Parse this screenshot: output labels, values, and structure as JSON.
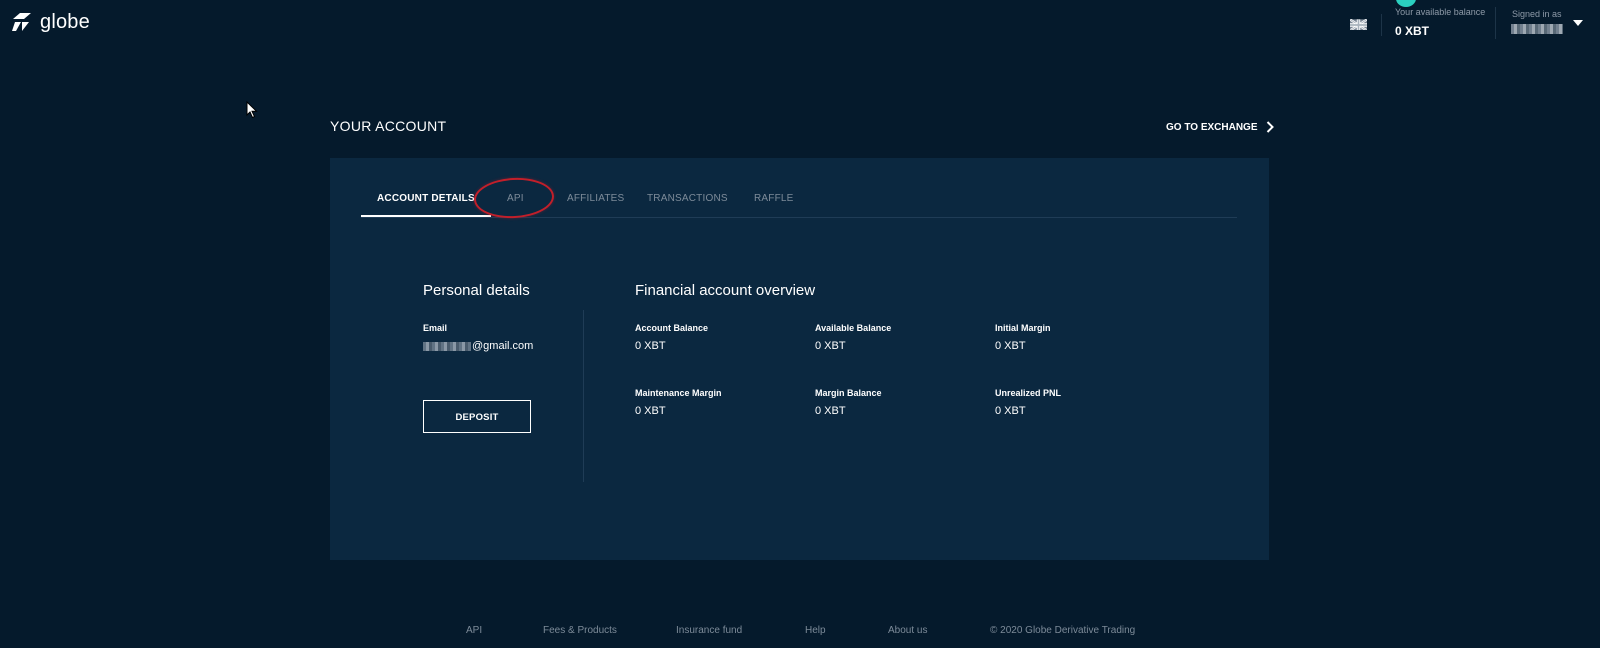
{
  "header": {
    "logo_text": "globe",
    "balance_label": "Your available balance",
    "balance_value": "0 XBT",
    "signed_in_label": "Signed in as"
  },
  "page": {
    "title": "YOUR ACCOUNT",
    "go_to_exchange": "GO TO EXCHANGE"
  },
  "tabs": [
    {
      "label": "ACCOUNT DETAILS",
      "active": true
    },
    {
      "label": "API",
      "active": false
    },
    {
      "label": "AFFILIATES",
      "active": false
    },
    {
      "label": "TRANSACTIONS",
      "active": false
    },
    {
      "label": "RAFFLE",
      "active": false
    }
  ],
  "personal": {
    "title": "Personal details",
    "email_label": "Email",
    "email_value": "@gmail.com",
    "deposit_label": "DEPOSIT"
  },
  "financial": {
    "title": "Financial account overview",
    "items": [
      {
        "label": "Account Balance",
        "value": "0 XBT"
      },
      {
        "label": "Available Balance",
        "value": "0 XBT"
      },
      {
        "label": "Initial Margin",
        "value": "0 XBT"
      },
      {
        "label": "Maintenance Margin",
        "value": "0 XBT"
      },
      {
        "label": "Margin Balance",
        "value": "0 XBT"
      },
      {
        "label": "Unrealized PNL",
        "value": "0 XBT"
      }
    ]
  },
  "footer": {
    "links": [
      "API",
      "Fees & Products",
      "Insurance fund",
      "Help",
      "About us"
    ],
    "copyright": "© 2020 Globe Derivative Trading"
  },
  "colors": {
    "background": "#051a2c",
    "panel": "#0b2840",
    "highlight_circle": "#c21f2a",
    "balance_dot": "#2bd0c0"
  }
}
